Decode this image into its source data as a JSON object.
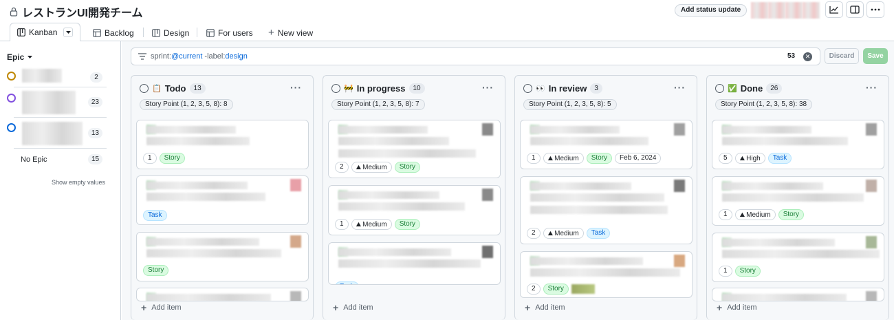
{
  "header": {
    "title": "レストランUI開発チーム",
    "status_button": "Add status update"
  },
  "tabs": [
    {
      "label": "Kanban"
    },
    {
      "label": "Backlog"
    },
    {
      "label": "Design"
    },
    {
      "label": "For users"
    },
    {
      "label": "New view"
    }
  ],
  "sidebar": {
    "heading": "Epic",
    "epics": [
      {
        "count": "2",
        "color": "#bf8700"
      },
      {
        "count": "23",
        "color": "#8250df"
      },
      {
        "count": "13",
        "color": "#0969da"
      }
    ],
    "no_epic_label": "No Epic",
    "no_epic_count": "15",
    "show_empty": "Show empty values"
  },
  "filter": {
    "prefix": "sprint:",
    "sprint_value": "@current",
    "mid": " -label:",
    "label_value": "design",
    "count": "53",
    "discard": "Discard",
    "save": "Save"
  },
  "columns": [
    {
      "emoji": "📋",
      "title": "Todo",
      "count": "13",
      "story_points": "Story Point (1, 2, 3, 5, 8): 8",
      "add_item": "Add item",
      "cards": [
        {
          "num": "1",
          "priority": "",
          "type": "Story",
          "date": ""
        },
        {
          "num": "",
          "priority": "",
          "type": "Task",
          "date": ""
        },
        {
          "num": "",
          "priority": "",
          "type": "Story",
          "date": ""
        }
      ]
    },
    {
      "emoji": "🚧",
      "title": "In progress",
      "count": "10",
      "story_points": "Story Point (1, 2, 3, 5, 8): 7",
      "add_item": "Add item",
      "cards": [
        {
          "num": "2",
          "priority": "Medium",
          "type": "Story",
          "date": ""
        },
        {
          "num": "1",
          "priority": "Medium",
          "type": "Story",
          "date": ""
        },
        {
          "num": "",
          "priority": "",
          "type": "Task",
          "date": ""
        }
      ]
    },
    {
      "emoji": "👀",
      "title": "In review",
      "count": "3",
      "story_points": "Story Point (1, 2, 3, 5, 8): 5",
      "add_item": "Add item",
      "cards": [
        {
          "num": "1",
          "priority": "Medium",
          "type": "Story",
          "date": "Feb 6, 2024"
        },
        {
          "num": "2",
          "priority": "Medium",
          "type": "Task",
          "date": ""
        },
        {
          "num": "2",
          "priority": "",
          "type": "Story",
          "date": ""
        }
      ]
    },
    {
      "emoji": "✅",
      "title": "Done",
      "count": "26",
      "story_points": "Story Point (1, 2, 3, 5, 8): 38",
      "add_item": "Add item",
      "cards": [
        {
          "num": "5",
          "priority": "High",
          "type": "Task",
          "date": ""
        },
        {
          "num": "1",
          "priority": "Medium",
          "type": "Story",
          "date": ""
        },
        {
          "num": "1",
          "priority": "",
          "type": "Story",
          "date": ""
        }
      ]
    }
  ]
}
